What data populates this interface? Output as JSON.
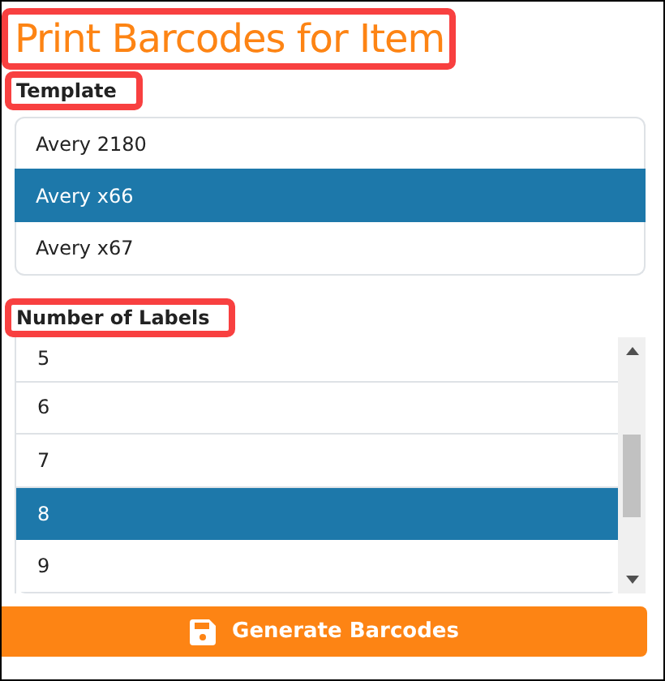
{
  "title": {
    "text": "Print Barcodes for Item",
    "highlighted": true
  },
  "template": {
    "label": "Template",
    "highlighted": true,
    "items": [
      {
        "text": "Avery 2180",
        "selected": false
      },
      {
        "text": "Avery x66",
        "selected": true
      },
      {
        "text": "Avery x67",
        "selected": false
      }
    ]
  },
  "number_of_labels": {
    "label": "Number of Labels",
    "highlighted": true,
    "items": [
      {
        "text": "5",
        "selected": false
      },
      {
        "text": "6",
        "selected": false
      },
      {
        "text": "7",
        "selected": false
      },
      {
        "text": "8",
        "selected": true
      },
      {
        "text": "9",
        "selected": false
      }
    ]
  },
  "button": {
    "label": "Generate Barcodes"
  }
}
